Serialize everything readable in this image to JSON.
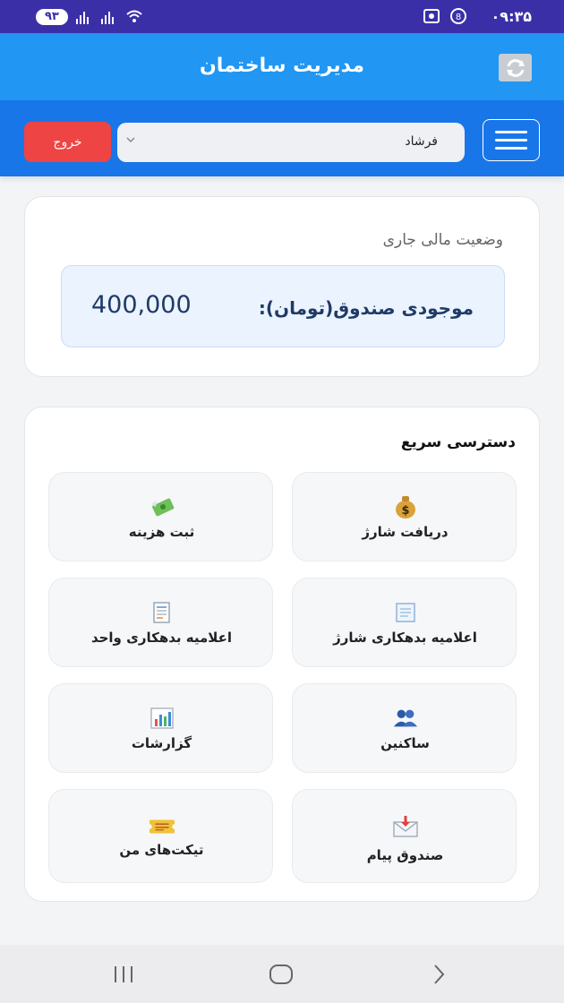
{
  "status_bar": {
    "time": "۰۹:۳۵",
    "battery": "۹۳"
  },
  "header": {
    "title": "مدیریت ساختمان"
  },
  "toolbar": {
    "exit_label": "خروج",
    "selected_user": "فرشاد"
  },
  "finance": {
    "title": "وضعیت مالی جاری",
    "balance_label": "موجودی صندوق(تومان):",
    "balance_value": "400,000"
  },
  "quick_access": {
    "title": "دسترسی سریع",
    "tiles": [
      {
        "label": "دریافت شارژ",
        "icon": "money-bag-icon"
      },
      {
        "label": "ثبت هزینه",
        "icon": "money-wings-icon"
      },
      {
        "label": "اعلامیه بدهکاری شارژ",
        "icon": "receipt-icon"
      },
      {
        "label": "اعلامیه بدهکاری واحد",
        "icon": "document-icon"
      },
      {
        "label": "ساکنین",
        "icon": "people-icon"
      },
      {
        "label": "گزارشات",
        "icon": "bar-chart-icon"
      },
      {
        "label": "صندوق پیام",
        "icon": "inbox-icon"
      },
      {
        "label": "تیکت‌های من",
        "icon": "ticket-icon"
      }
    ]
  },
  "colors": {
    "status_bar": "#3b2fa8",
    "title_bar": "#2196f3",
    "toolbar": "#1976e8",
    "exit_button": "#ef4444",
    "balance_text": "#1f3a66"
  }
}
